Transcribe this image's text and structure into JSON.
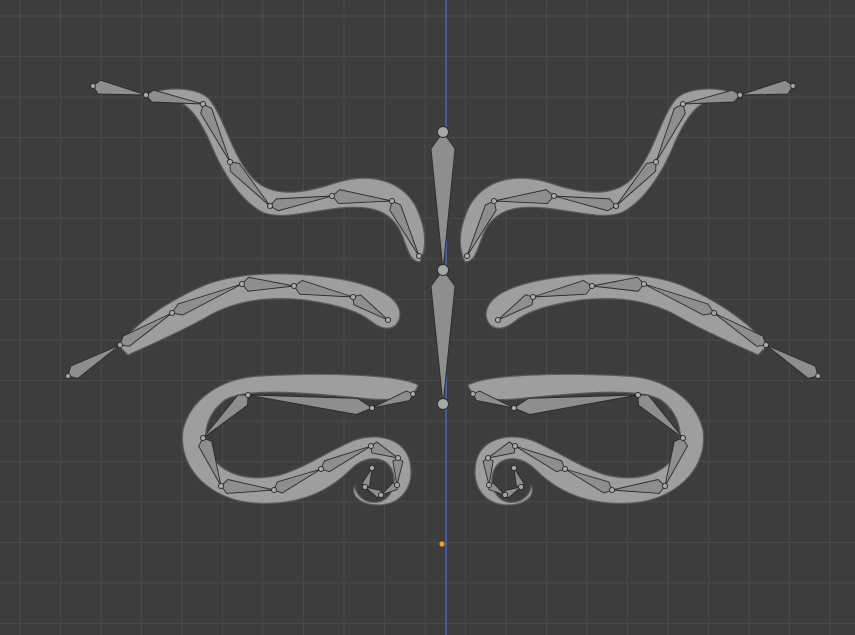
{
  "viewport": {
    "background": "#3d3d3d",
    "grid_color": "#4a4a4a",
    "axis_color": "#4f6fd9",
    "origin_color": "#e8a230",
    "mesh_fill": "#9b9b9b",
    "mesh_highlight": "#bdbdbd",
    "mesh_outline": "#5a5a5a",
    "bone_fill": "#8e8e8e",
    "bone_outline": "#2a2a2a"
  },
  "icons": {
    "origin": "origin-point-icon"
  }
}
